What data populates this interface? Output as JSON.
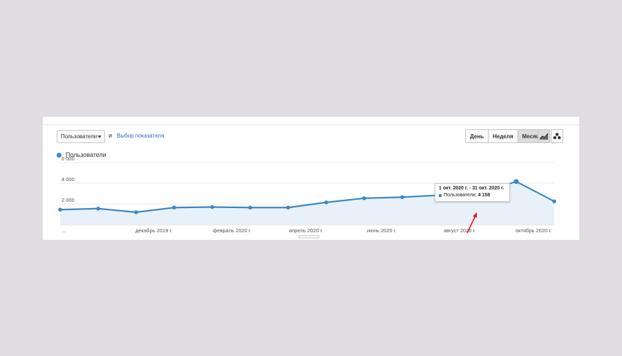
{
  "toolbar": {
    "metric_select_value": "Пользователи",
    "conjunction": "и",
    "pick_metric_link": "Выбор показателя",
    "granularity": [
      "День",
      "Неделя",
      "Месяц"
    ],
    "active_granularity": "Месяц",
    "view_icons": [
      "line-chart-icon",
      "motion-chart-icon"
    ]
  },
  "legend": {
    "label": "Пользователи",
    "color": "#3b87c3"
  },
  "tooltip": {
    "range": "1 окт. 2020 г. - 31 окт. 2020 г.",
    "metric": "Пользователи:",
    "value": "4 158"
  },
  "chart_data": {
    "type": "area",
    "series": [
      {
        "name": "Пользователи",
        "color": "#3b87c3",
        "values": [
          1450,
          1550,
          1200,
          1650,
          1700,
          1650,
          1650,
          2150,
          2550,
          2650,
          2850,
          3000,
          4158,
          2250
        ]
      }
    ],
    "x_tick_labels": [
      "...",
      "декабрь 2019 г.",
      "февраль 2020 г.",
      "апрель 2020 г.",
      "июнь 2020 г.",
      "август 2020 г.",
      "октябрь 2020 г."
    ],
    "y_tick_labels": [
      "6 000",
      "4 000",
      "2 000"
    ],
    "y_ticks": [
      6000,
      4000,
      2000
    ],
    "ylim": [
      0,
      6000
    ],
    "grid": true
  }
}
